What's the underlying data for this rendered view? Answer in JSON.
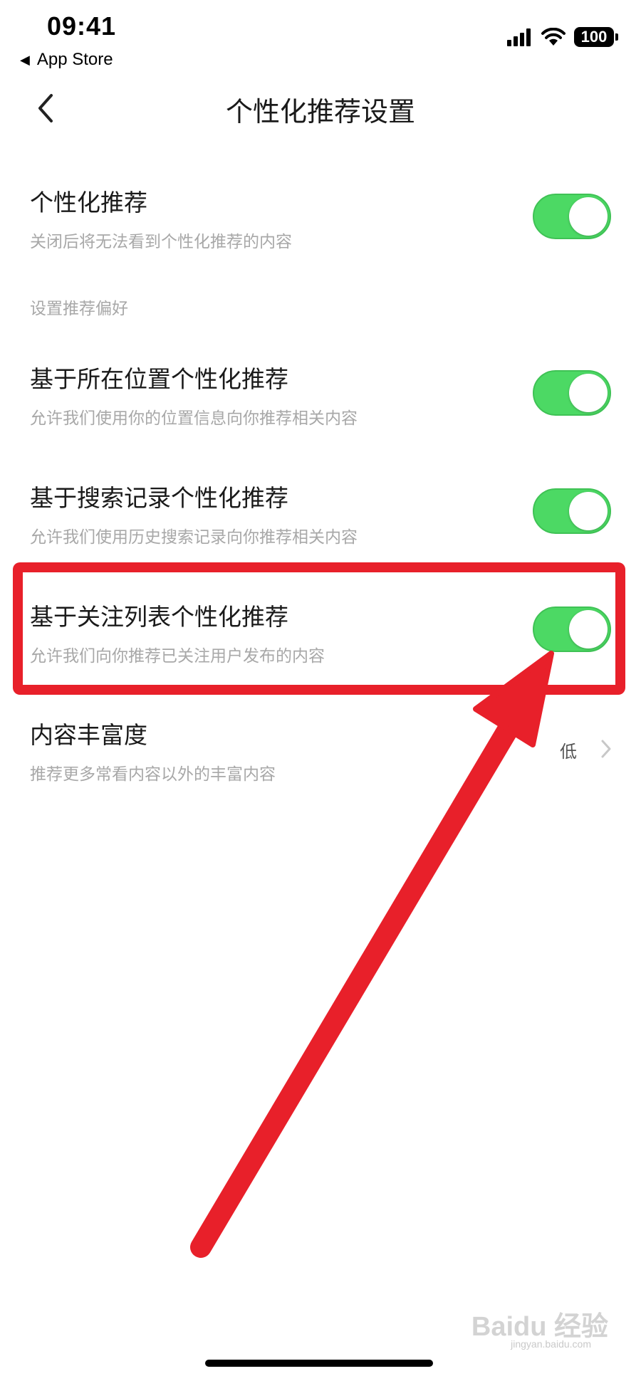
{
  "status_bar": {
    "time": "09:41",
    "back_app": "App Store",
    "battery": "100"
  },
  "nav": {
    "back_icon": "chevron-left-icon",
    "title": "个性化推荐设置"
  },
  "settings": {
    "personalized": {
      "title": "个性化推荐",
      "subtitle": "关闭后将无法看到个性化推荐的内容",
      "enabled": true
    },
    "section_label": "设置推荐偏好",
    "location": {
      "title": "基于所在位置个性化推荐",
      "subtitle": "允许我们使用你的位置信息向你推荐相关内容",
      "enabled": true
    },
    "search": {
      "title": "基于搜索记录个性化推荐",
      "subtitle": "允许我们使用历史搜索记录向你推荐相关内容",
      "enabled": true
    },
    "follow": {
      "title": "基于关注列表个性化推荐",
      "subtitle": "允许我们向你推荐已关注用户发布的内容",
      "enabled": true
    },
    "richness": {
      "title": "内容丰富度",
      "subtitle": "推荐更多常看内容以外的丰富内容",
      "value": "低"
    }
  },
  "colors": {
    "toggle_on": "#4cd964",
    "annotation_red": "#e8202a"
  },
  "watermark": {
    "main": "Baidu 经验",
    "sub": "jingyan.baidu.com"
  }
}
